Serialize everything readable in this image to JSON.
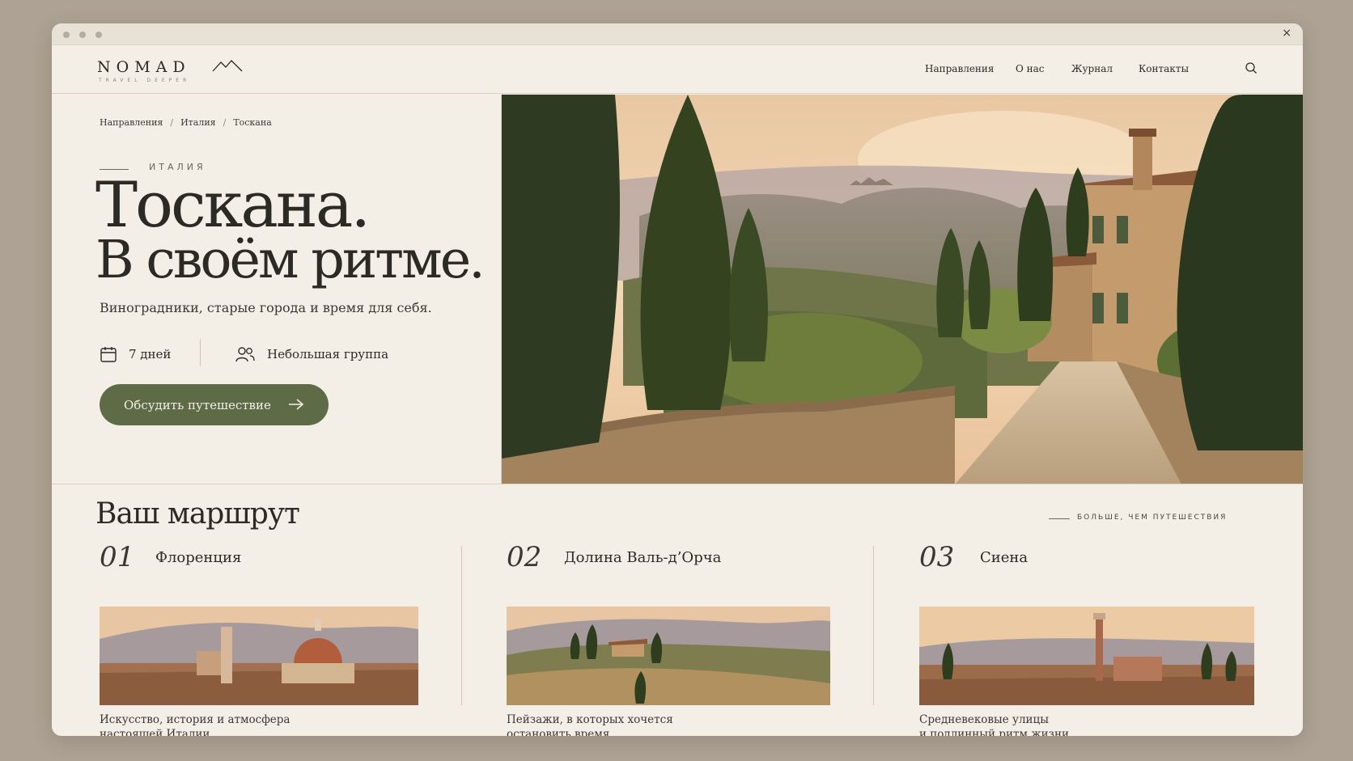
{
  "window": {
    "close_label": "×"
  },
  "header": {
    "logo": "NOMAD",
    "tagline": "TRAVEL DEEPER",
    "nav": [
      "Направления",
      "О нас",
      "Журнал",
      "Контакты"
    ]
  },
  "hero": {
    "breadcrumbs": [
      "Направления",
      "Италия",
      "Тоскана"
    ],
    "breadcrumb_sep": "/",
    "eyebrow": "ИТАЛИЯ",
    "title_line1": "Тоскана.",
    "title_line2": "В своём ритме.",
    "subtitle": "Виноградники, старые города и время для себя.",
    "duration": "7 дней",
    "group": "Небольшая группа",
    "cta": "Обсудить путешествие"
  },
  "route": {
    "title": "Ваш маршрут",
    "tagline": "БОЛЬШЕ, ЧЕМ ПУТЕШЕСТВИЯ",
    "stops": [
      {
        "num": "01",
        "name": "Флоренция",
        "desc1": "Искусство, история и атмосфера",
        "desc2": "настоящей Италии."
      },
      {
        "num": "02",
        "name": "Долина Валь-д’Орча",
        "desc1": "Пейзажи, в которых хочется",
        "desc2": "остановить время."
      },
      {
        "num": "03",
        "name": "Сиена",
        "desc1": "Средневековые улицы",
        "desc2": "и подлинный ритм жизни."
      }
    ]
  },
  "colors": {
    "accent": "#5d6b47",
    "background": "#f4efe6",
    "text": "#2b2a24"
  },
  "icons": [
    "logo-mountain-icon",
    "search-icon",
    "calendar-icon",
    "group-icon",
    "arrow-right-icon",
    "close-icon"
  ]
}
